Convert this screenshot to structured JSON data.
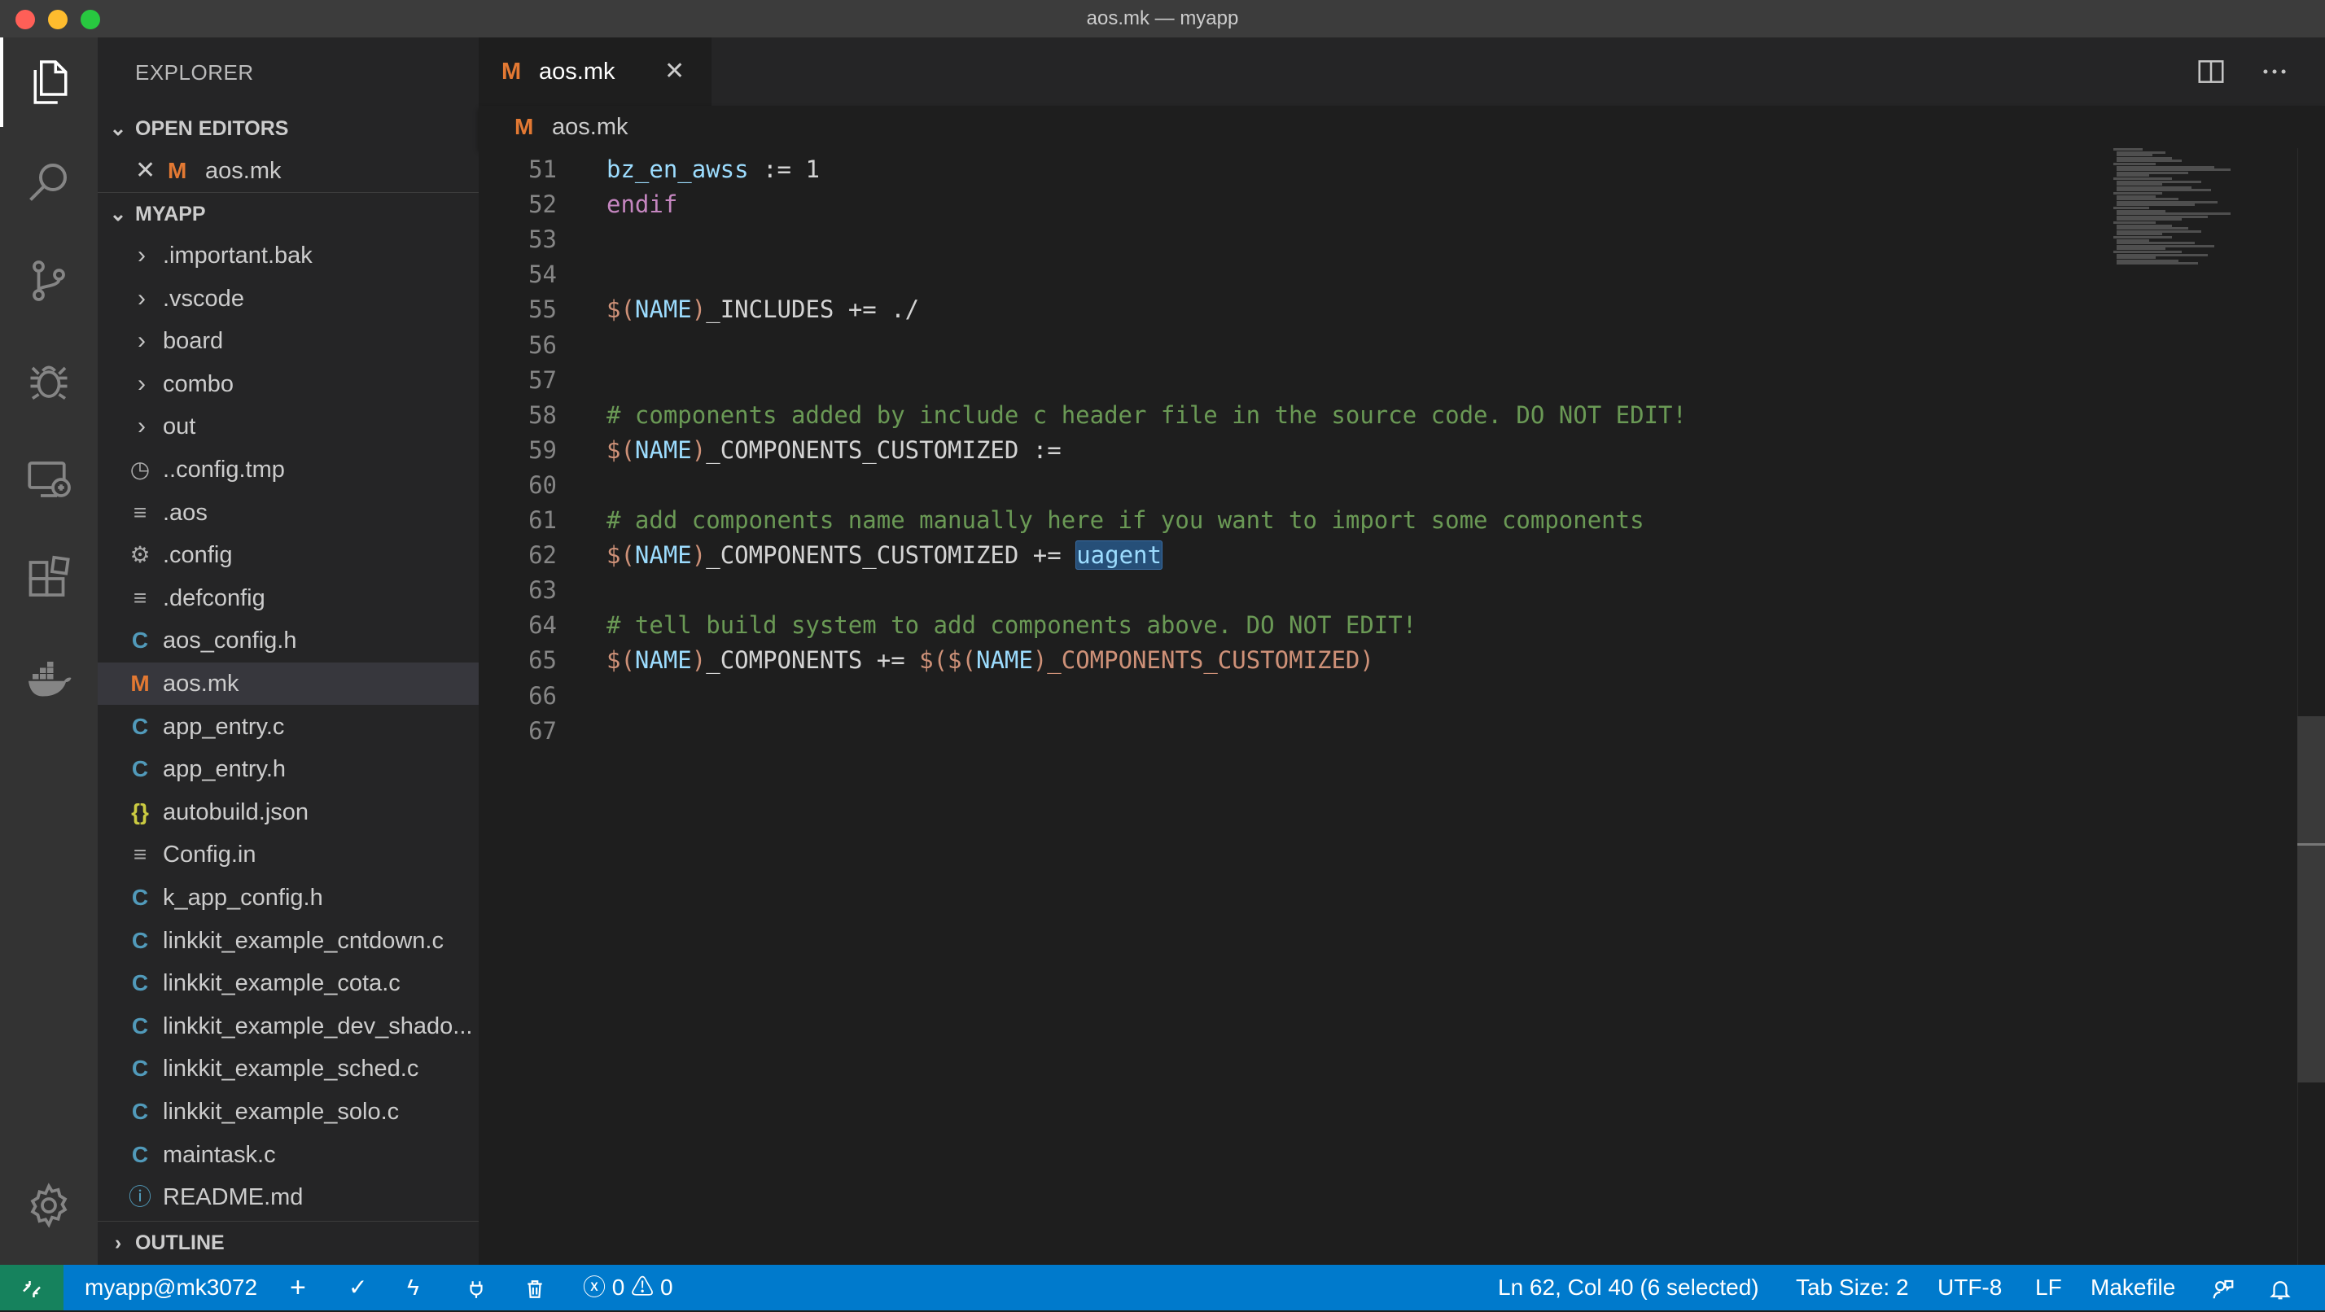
{
  "window": {
    "title": "aos.mk — myapp"
  },
  "activity_bar": {
    "items": [
      "files-icon",
      "search-icon",
      "source-control-icon",
      "debug-icon",
      "remote-explorer-icon",
      "extensions-icon",
      "docker-icon"
    ],
    "bottom": "settings-gear-icon"
  },
  "sidebar": {
    "title": "EXPLORER",
    "open_editors": {
      "header": "OPEN EDITORS",
      "items": [
        {
          "icon": "M",
          "label": "aos.mk"
        }
      ]
    },
    "project": {
      "header": "MYAPP",
      "items": [
        {
          "type": "folder",
          "label": ".important.bak"
        },
        {
          "type": "folder",
          "label": ".vscode"
        },
        {
          "type": "folder",
          "label": "board"
        },
        {
          "type": "folder",
          "label": "combo"
        },
        {
          "type": "folder",
          "label": "out"
        },
        {
          "type": "file",
          "icon": "clock",
          "label": "..config.tmp"
        },
        {
          "type": "file",
          "icon": "lines",
          "label": ".aos"
        },
        {
          "type": "file",
          "icon": "gear",
          "label": ".config"
        },
        {
          "type": "file",
          "icon": "lines",
          "label": ".defconfig"
        },
        {
          "type": "file",
          "icon": "C",
          "label": "aos_config.h"
        },
        {
          "type": "file",
          "icon": "M",
          "label": "aos.mk",
          "selected": true
        },
        {
          "type": "file",
          "icon": "C",
          "label": "app_entry.c"
        },
        {
          "type": "file",
          "icon": "C",
          "label": "app_entry.h"
        },
        {
          "type": "file",
          "icon": "{}",
          "label": "autobuild.json"
        },
        {
          "type": "file",
          "icon": "lines",
          "label": "Config.in"
        },
        {
          "type": "file",
          "icon": "C",
          "label": "k_app_config.h"
        },
        {
          "type": "file",
          "icon": "C",
          "label": "linkkit_example_cntdown.c"
        },
        {
          "type": "file",
          "icon": "C",
          "label": "linkkit_example_cota.c"
        },
        {
          "type": "file",
          "icon": "C",
          "label": "linkkit_example_dev_shado..."
        },
        {
          "type": "file",
          "icon": "C",
          "label": "linkkit_example_sched.c"
        },
        {
          "type": "file",
          "icon": "C",
          "label": "linkkit_example_solo.c"
        },
        {
          "type": "file",
          "icon": "C",
          "label": "maintask.c"
        },
        {
          "type": "file",
          "icon": "info",
          "label": "README.md"
        }
      ]
    },
    "outline": {
      "header": "OUTLINE"
    }
  },
  "editor": {
    "tab": {
      "icon": "M",
      "label": "aos.mk"
    },
    "breadcrumb": {
      "icon": "M",
      "label": "aos.mk"
    },
    "lines": [
      {
        "n": "51",
        "tokens": [
          [
            "var",
            "bz_en_awss"
          ],
          [
            "op",
            " := 1"
          ]
        ]
      },
      {
        "n": "52",
        "tokens": [
          [
            "kw",
            "endif"
          ]
        ]
      },
      {
        "n": "53",
        "tokens": []
      },
      {
        "n": "54",
        "tokens": []
      },
      {
        "n": "55",
        "tokens": [
          [
            "punct",
            "$("
          ],
          [
            "var",
            "NAME"
          ],
          [
            "punct",
            ")"
          ],
          [
            "op",
            "_INCLUDES += ./"
          ]
        ]
      },
      {
        "n": "56",
        "tokens": []
      },
      {
        "n": "57",
        "tokens": []
      },
      {
        "n": "58",
        "tokens": [
          [
            "comment",
            "# components added by include c header file in the source code. DO NOT EDIT!"
          ]
        ]
      },
      {
        "n": "59",
        "tokens": [
          [
            "punct",
            "$("
          ],
          [
            "var",
            "NAME"
          ],
          [
            "punct",
            ")"
          ],
          [
            "op",
            "_COMPONENTS_CUSTOMIZED :="
          ]
        ]
      },
      {
        "n": "60",
        "tokens": []
      },
      {
        "n": "61",
        "tokens": [
          [
            "comment",
            "# add components name manually here if you want to import some components"
          ]
        ]
      },
      {
        "n": "62",
        "tokens": [
          [
            "punct",
            "$("
          ],
          [
            "var",
            "NAME"
          ],
          [
            "punct",
            ")"
          ],
          [
            "op",
            "_COMPONENTS_CUSTOMIZED += "
          ],
          [
            "sel",
            "uagent"
          ]
        ]
      },
      {
        "n": "63",
        "tokens": []
      },
      {
        "n": "64",
        "tokens": [
          [
            "comment",
            "# tell build system to add components above. DO NOT EDIT!"
          ]
        ]
      },
      {
        "n": "65",
        "tokens": [
          [
            "punct",
            "$("
          ],
          [
            "var",
            "NAME"
          ],
          [
            "punct",
            ")"
          ],
          [
            "op",
            "_COMPONENTS += "
          ],
          [
            "punct",
            "$($("
          ],
          [
            "var",
            "NAME"
          ],
          [
            "punct",
            ")_COMPONENTS_CUSTOMIZED)"
          ]
        ]
      },
      {
        "n": "66",
        "tokens": []
      },
      {
        "n": "67",
        "tokens": []
      }
    ]
  },
  "statusbar": {
    "remote_icon": "remote-icon",
    "workspace": "myapp@mk3072",
    "errors": "0",
    "warnings": "0",
    "position": "Ln 62, Col 40 (6 selected)",
    "tab_size": "Tab Size: 2",
    "encoding": "UTF-8",
    "eol": "LF",
    "language": "Makefile"
  },
  "colors": {
    "titlebar": "#3c3c3c",
    "activitybar": "#333333",
    "sidebar": "#252526",
    "editor": "#1e1e1e",
    "statusbar": "#007acc",
    "remote": "#16825d"
  }
}
